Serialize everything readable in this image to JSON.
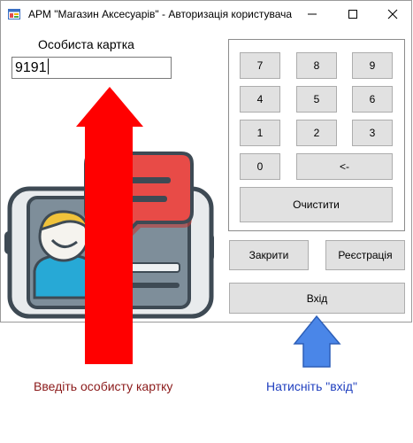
{
  "window": {
    "title": "АРМ \"Магазин Аксесуарів\" - Авторизація користувача",
    "icons": [
      "app-icon",
      "minimize-icon",
      "maximize-icon",
      "close-icon"
    ]
  },
  "card": {
    "label": "Особиста картка",
    "value": "9191"
  },
  "keypad": {
    "keys": [
      "7",
      "8",
      "9",
      "4",
      "5",
      "6",
      "1",
      "2",
      "3",
      "0",
      "<-"
    ],
    "clear_label": "Очистити"
  },
  "actions": {
    "close_label": "Закрити",
    "register_label": "Реєстрація",
    "login_label": "Вхід"
  },
  "hints": {
    "left_text": "Введіть особисту картку",
    "right_text": "Натисніть \"вхід\"",
    "left_color": "#8b1a1a",
    "right_color": "#1f3fbf"
  },
  "illustration": {
    "icon": "phone-chat-illustration",
    "arrow_colors": [
      "#ff0000",
      "#4a86e8"
    ]
  }
}
